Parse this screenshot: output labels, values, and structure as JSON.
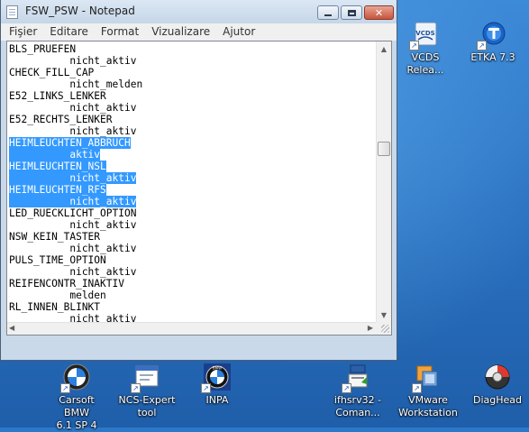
{
  "window": {
    "title": "FSW_PSW - Notepad",
    "buttons": {
      "close": "✕"
    }
  },
  "menu": [
    "Fişier",
    "Editare",
    "Format",
    "Vizualizare",
    "Ajutor"
  ],
  "lines": [
    {
      "text": "BLS_PRUEFEN",
      "selected": false
    },
    {
      "text": "          nicht_aktiv",
      "selected": false
    },
    {
      "text": "CHECK_FILL_CAP",
      "selected": false
    },
    {
      "text": "          nicht_melden",
      "selected": false
    },
    {
      "text": "E52_LINKS_LENKER",
      "selected": false
    },
    {
      "text": "          nicht_aktiv",
      "selected": false
    },
    {
      "text": "E52_RECHTS_LENKER",
      "selected": false
    },
    {
      "text": "          nicht_aktiv",
      "selected": false
    },
    {
      "text": "HEIMLEUCHTEN_ABBRUCH",
      "selected": true
    },
    {
      "text": "          aktiv",
      "selected": true
    },
    {
      "text": "HEIMLEUCHTEN_NSL",
      "selected": true
    },
    {
      "text": "          nicht_aktiv",
      "selected": true
    },
    {
      "text": "HEIMLEUCHTEN_RFS",
      "selected": true
    },
    {
      "text": "          nicht_aktiv",
      "selected": true
    },
    {
      "text": "LED_RUECKLICHT_OPTION",
      "selected": false
    },
    {
      "text": "          nicht_aktiv",
      "selected": false
    },
    {
      "text": "NSW_KEIN_TASTER",
      "selected": false
    },
    {
      "text": "          nicht_aktiv",
      "selected": false
    },
    {
      "text": "PULS_TIME_OPTION",
      "selected": false
    },
    {
      "text": "          nicht_aktiv",
      "selected": false
    },
    {
      "text": "REIFENCONTR_INAKTIV",
      "selected": false
    },
    {
      "text": "          melden",
      "selected": false
    },
    {
      "text": "RL_INNEN_BLINKT",
      "selected": false
    },
    {
      "text": "          nicht_aktiv",
      "selected": false
    }
  ],
  "scrollbar": {
    "up": "▲",
    "down": "▼",
    "left": "◀",
    "right": "▶"
  },
  "desktop_icons": {
    "vcds": {
      "label": "VCDS\nRelea...",
      "logo": "VCDS"
    },
    "etka": {
      "label": "ETKA 7.3"
    },
    "carsoft": {
      "label": "Carsoft BMW\n6.1 SP 4"
    },
    "ncs": {
      "label": "NCS-Expert\ntool"
    },
    "inpa": {
      "label": "INPA",
      "logo": "BMW"
    },
    "ifhsrv": {
      "label": "ifhsrv32 -\nComan..."
    },
    "vmware": {
      "label": "VMware\nWorkstation"
    },
    "diag": {
      "label": "DiagHead"
    }
  },
  "colors": {
    "selection": "#3399ff",
    "desktop": "#2c74c4"
  }
}
